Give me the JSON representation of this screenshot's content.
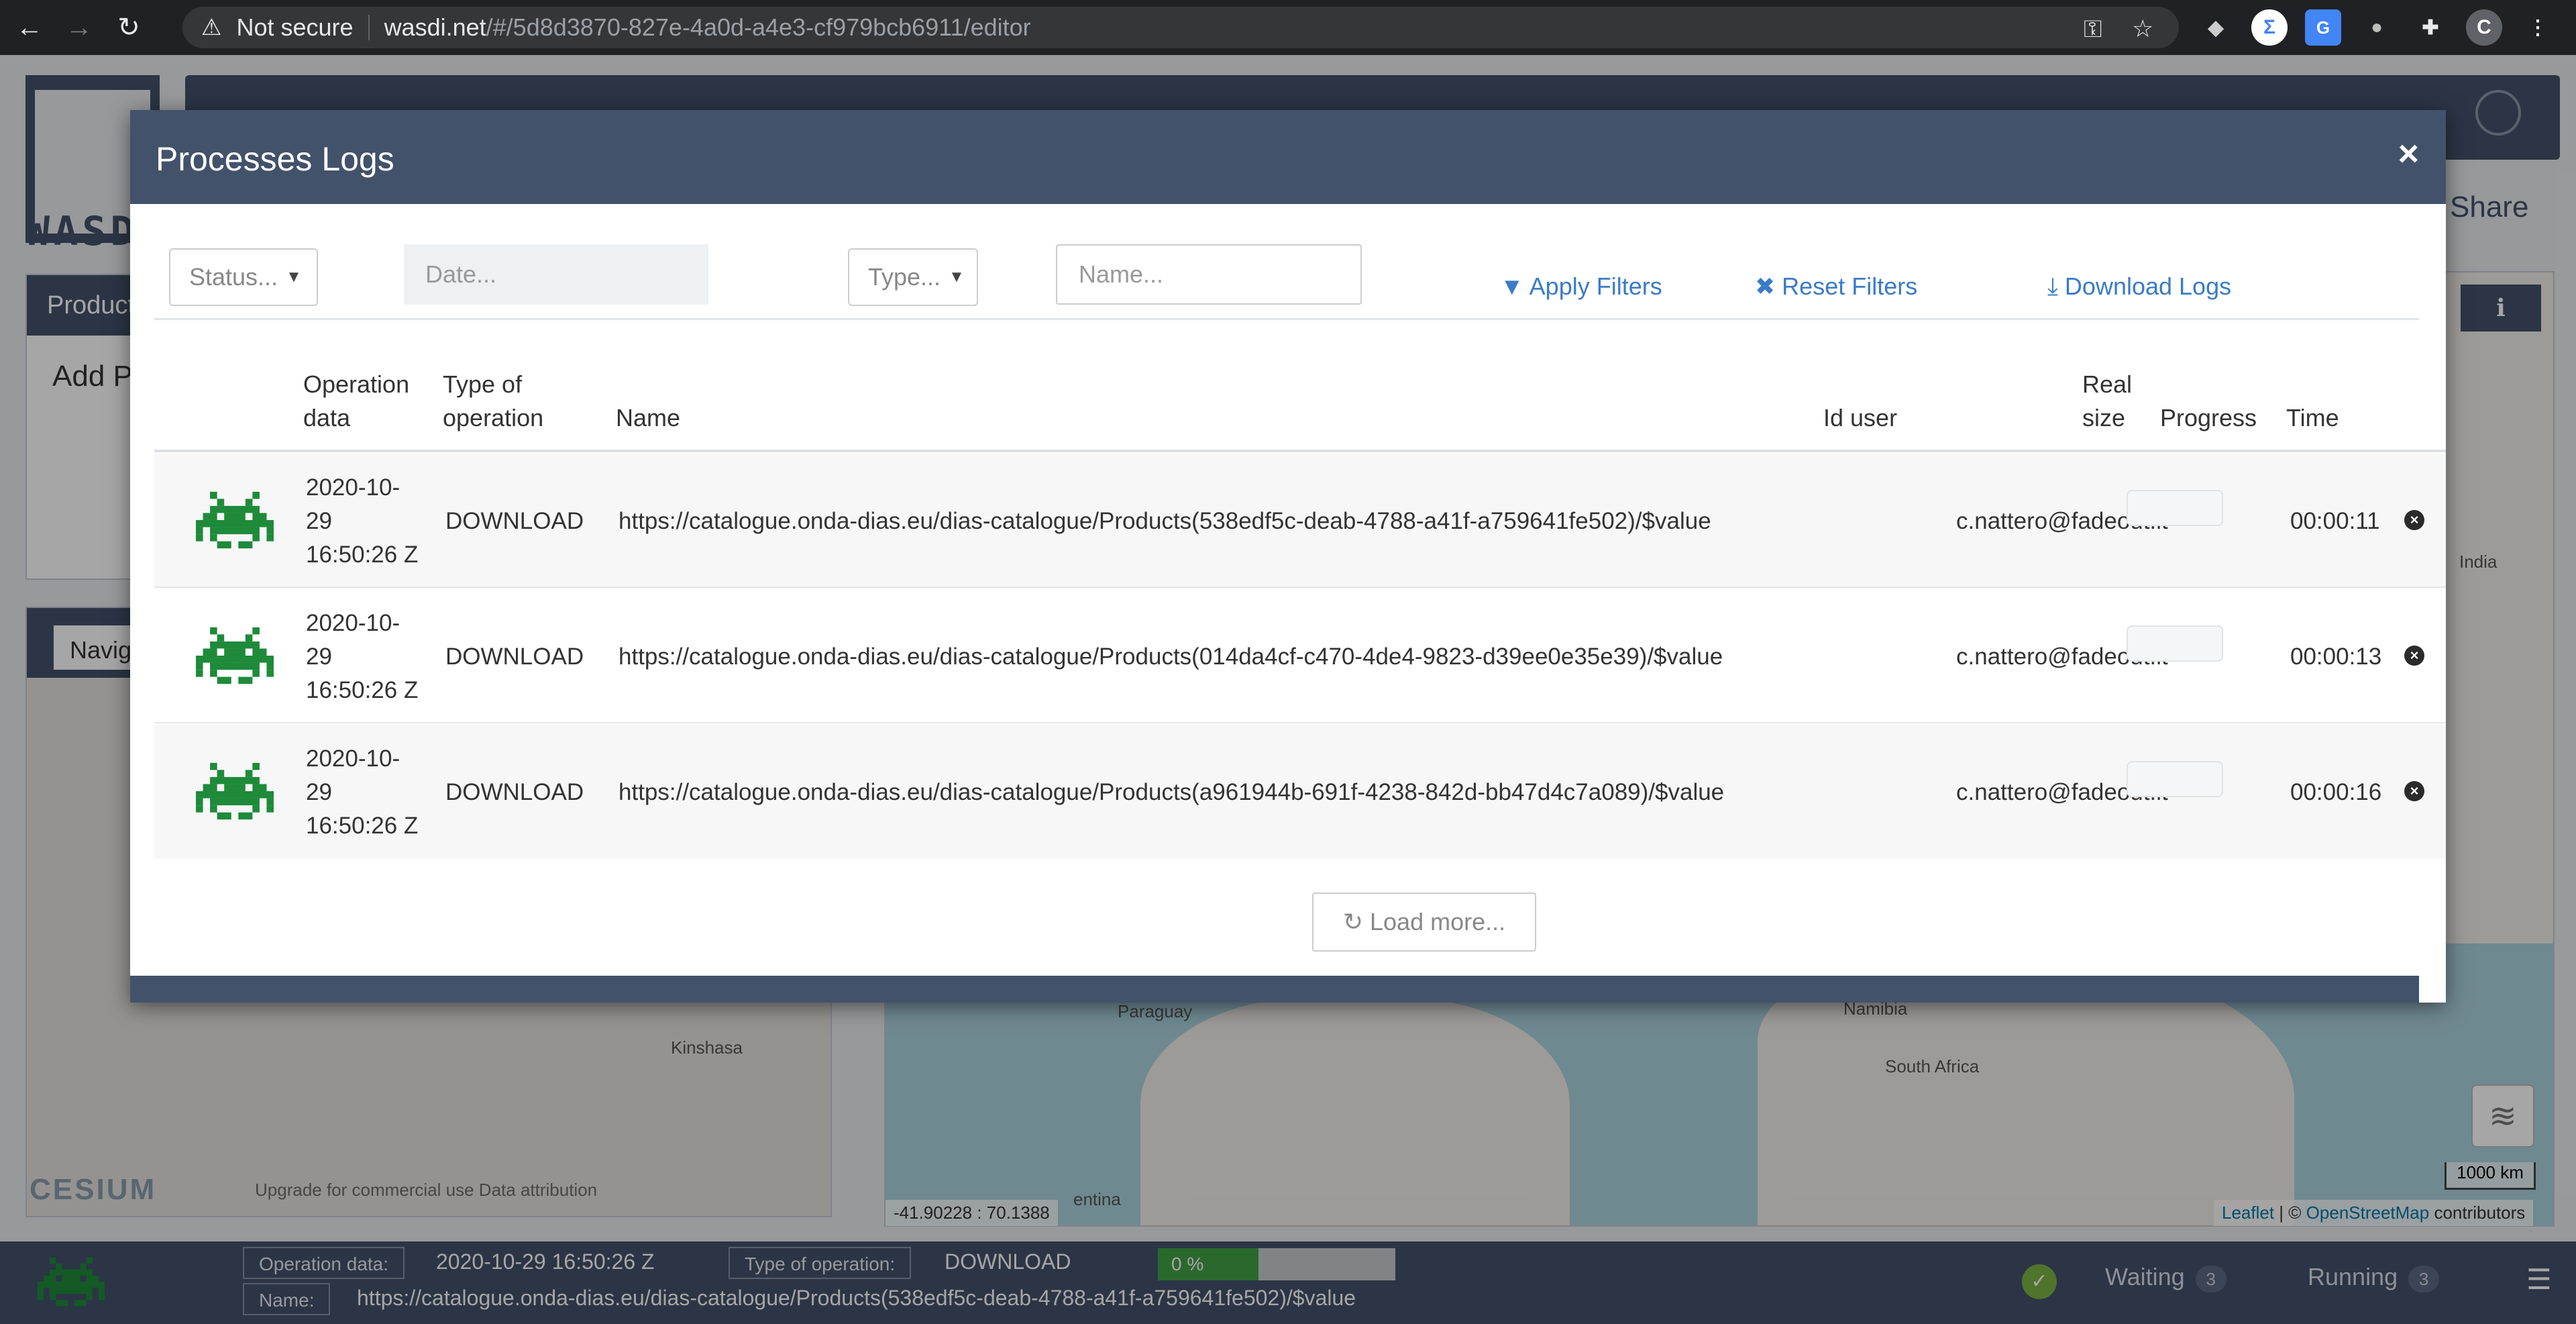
{
  "browser": {
    "not_secure": "Not secure",
    "host": "wasdi.net",
    "path": "/#/5d8d3870-827e-4a0d-a4e3-cf979bcb6911/editor",
    "profile_initial": "C"
  },
  "app": {
    "share": "Share",
    "left_panel_title": "Product",
    "add_text": "Add P",
    "navigation_tab": "Navig",
    "cesium_logo": "CESIUM",
    "cesium_attribution": "Upgrade for commercial use   Data attribution",
    "map_labels": {
      "paraguay": "Paraguay",
      "namibia": "Namibia",
      "south_africa": "South Africa",
      "india": "India",
      "argentina": "entina",
      "kinshasa": "Kinshasa"
    },
    "coordinates": "-41.90228 : 70.1388",
    "scale": "1000 km",
    "attribution_leaflet": "Leaflet",
    "attribution_sep": " | © ",
    "attribution_osm": "OpenStreetMap",
    "attribution_tail": " contributors"
  },
  "modal": {
    "title": "Processes Logs",
    "close": "×",
    "filters": {
      "status": "Status...",
      "date_placeholder": "Date...",
      "type": "Type...",
      "name_placeholder": "Name...",
      "apply": "Apply Filters",
      "reset": "Reset Filters",
      "download": "Download Logs"
    },
    "columns": {
      "operation_data_1": "Operation",
      "operation_data_2": "data",
      "type_1": "Type of",
      "type_2": "operation",
      "name": "Name",
      "id_user": "Id user",
      "real_size_1": "Real",
      "real_size_2": "size",
      "progress": "Progress",
      "time": "Time"
    },
    "rows": [
      {
        "date_1": "2020-10-",
        "date_2": "29",
        "date_3": "16:50:26 Z",
        "type": "DOWNLOAD",
        "name": "https://catalogue.onda-dias.eu/dias-catalogue/Products(538edf5c-deab-4788-a41f-a759641fe502)/$value",
        "user": "c.nattero@fadeout.it",
        "time": "00:00:11"
      },
      {
        "date_1": "2020-10-",
        "date_2": "29",
        "date_3": "16:50:26 Z",
        "type": "DOWNLOAD",
        "name": "https://catalogue.onda-dias.eu/dias-catalogue/Products(014da4cf-c470-4de4-9823-d39ee0e35e39)/$value",
        "user": "c.nattero@fadeout.it",
        "time": "00:00:13"
      },
      {
        "date_1": "2020-10-",
        "date_2": "29",
        "date_3": "16:50:26 Z",
        "type": "DOWNLOAD",
        "name": "https://catalogue.onda-dias.eu/dias-catalogue/Products(a961944b-691f-4238-842d-bb47d4c7a089)/$value",
        "user": "c.nattero@fadeout.it",
        "time": "00:00:16"
      }
    ],
    "load_more": "Load more..."
  },
  "bottom_bar": {
    "operation_data_label": "Operation data:",
    "operation_data_value": "2020-10-29 16:50:26 Z",
    "type_label": "Type of operation:",
    "type_value": "DOWNLOAD",
    "progress_text": "0 %",
    "progress_fraction": 0.0,
    "name_label": "Name:",
    "name_value": "https://catalogue.onda-dias.eu/dias-catalogue/Products(538edf5c-deab-4788-a41f-a759641fe502)/$value",
    "waiting_label": "Waiting",
    "waiting_count": "3",
    "running_label": "Running",
    "running_count": "3"
  },
  "colors": {
    "brand": "#43526b",
    "link": "#3a7bc8",
    "alien_green": "#1e8a3a",
    "progress_green": "#43a047"
  }
}
